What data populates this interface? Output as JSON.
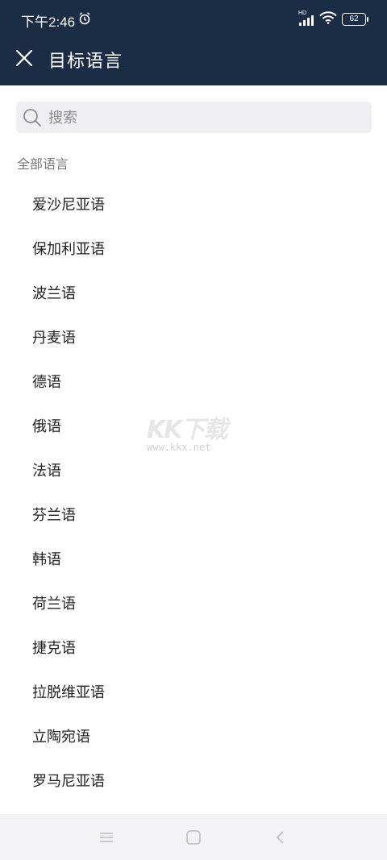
{
  "status_bar": {
    "time": "下午2:46",
    "network": "HD",
    "battery": "62"
  },
  "header": {
    "title": "目标语言"
  },
  "search": {
    "placeholder": "搜索"
  },
  "section_label": "全部语言",
  "languages": [
    "爱沙尼亚语",
    "保加利亚语",
    "波兰语",
    "丹麦语",
    "德语",
    "俄语",
    "法语",
    "芬兰语",
    "韩语",
    "荷兰语",
    "捷克语",
    "拉脱维亚语",
    "立陶宛语",
    "罗马尼亚语"
  ],
  "watermark": {
    "logo": "KK下载",
    "url": "www.kkx.net"
  },
  "colors": {
    "header_bg": "#1b2c45",
    "search_bg": "#efeff3"
  }
}
